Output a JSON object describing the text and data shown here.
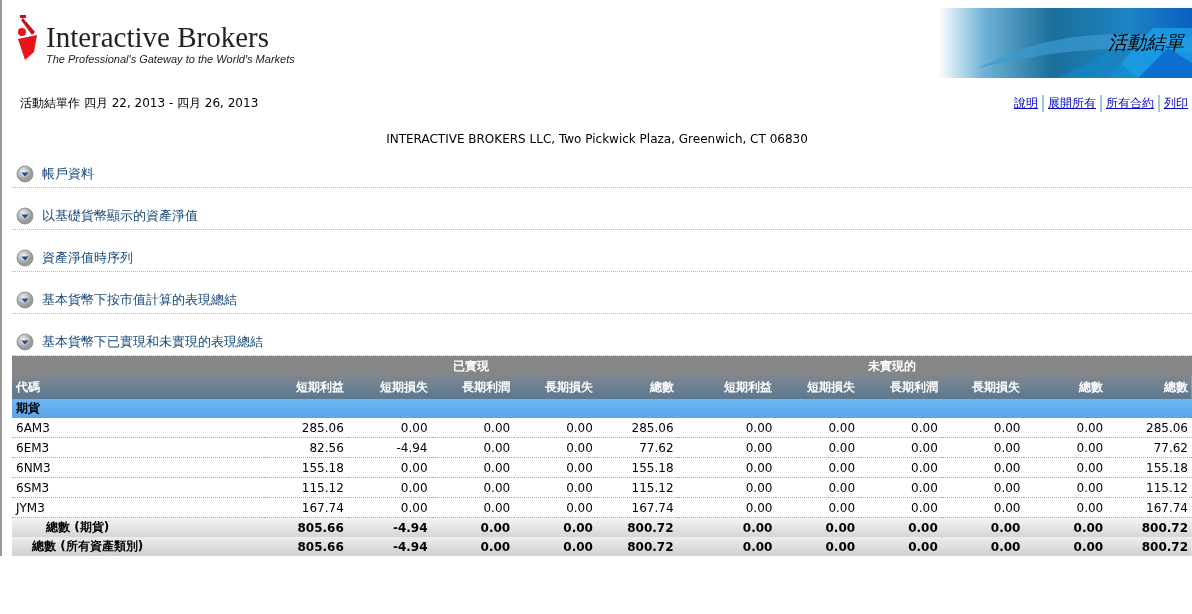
{
  "header": {
    "logo_name": "Interactive Brokers",
    "tagline": "The Professional's Gateway to the World's Markets",
    "banner_title": "活動結單"
  },
  "statement_period": "活動結單作 四月 22, 2013 - 四月 26, 2013",
  "links": [
    "說明",
    "展開所有",
    "所有合約",
    "列印"
  ],
  "address": "INTERACTIVE BROKERS LLC, Two Pickwick Plaza, Greenwich, CT 06830",
  "sections": [
    {
      "title": "帳戶資料"
    },
    {
      "title": "以基礎貨幣顯示的資產淨值"
    },
    {
      "title": "資產淨值時序列"
    },
    {
      "title": "基本貨幣下按市值計算的表現總結"
    },
    {
      "title": "基本貨幣下已實現和未實現的表現總結"
    }
  ],
  "table": {
    "symbol_column": "代碼",
    "column_groups": [
      {
        "label": "已實現",
        "columns": [
          "短期利益",
          "短期損失",
          "長期利潤",
          "長期損失",
          "總數"
        ]
      },
      {
        "label": "未實現的",
        "columns": [
          "短期利益",
          "短期損失",
          "長期利潤",
          "長期損失",
          "總數"
        ]
      }
    ],
    "total_column": "總數",
    "rows": [
      {
        "kind": "category",
        "label": "期貨"
      },
      {
        "kind": "data",
        "label": "6AM3",
        "values": [
          "285.06",
          "0.00",
          "0.00",
          "0.00",
          "285.06",
          "0.00",
          "0.00",
          "0.00",
          "0.00",
          "0.00",
          "285.06"
        ]
      },
      {
        "kind": "data",
        "label": "6EM3",
        "values": [
          "82.56",
          "-4.94",
          "0.00",
          "0.00",
          "77.62",
          "0.00",
          "0.00",
          "0.00",
          "0.00",
          "0.00",
          "77.62"
        ]
      },
      {
        "kind": "data",
        "label": "6NM3",
        "values": [
          "155.18",
          "0.00",
          "0.00",
          "0.00",
          "155.18",
          "0.00",
          "0.00",
          "0.00",
          "0.00",
          "0.00",
          "155.18"
        ]
      },
      {
        "kind": "data",
        "label": "6SM3",
        "values": [
          "115.12",
          "0.00",
          "0.00",
          "0.00",
          "115.12",
          "0.00",
          "0.00",
          "0.00",
          "0.00",
          "0.00",
          "115.12"
        ]
      },
      {
        "kind": "data",
        "label": "JYM3",
        "values": [
          "167.74",
          "0.00",
          "0.00",
          "0.00",
          "167.74",
          "0.00",
          "0.00",
          "0.00",
          "0.00",
          "0.00",
          "167.74"
        ]
      },
      {
        "kind": "subtotal",
        "label": "總數 (期貨)",
        "values": [
          "805.66",
          "-4.94",
          "0.00",
          "0.00",
          "800.72",
          "0.00",
          "0.00",
          "0.00",
          "0.00",
          "0.00",
          "800.72"
        ]
      },
      {
        "kind": "total",
        "label": "總數 (所有資產類別)",
        "values": [
          "805.66",
          "-4.94",
          "0.00",
          "0.00",
          "800.72",
          "0.00",
          "0.00",
          "0.00",
          "0.00",
          "0.00",
          "800.72"
        ]
      }
    ]
  }
}
